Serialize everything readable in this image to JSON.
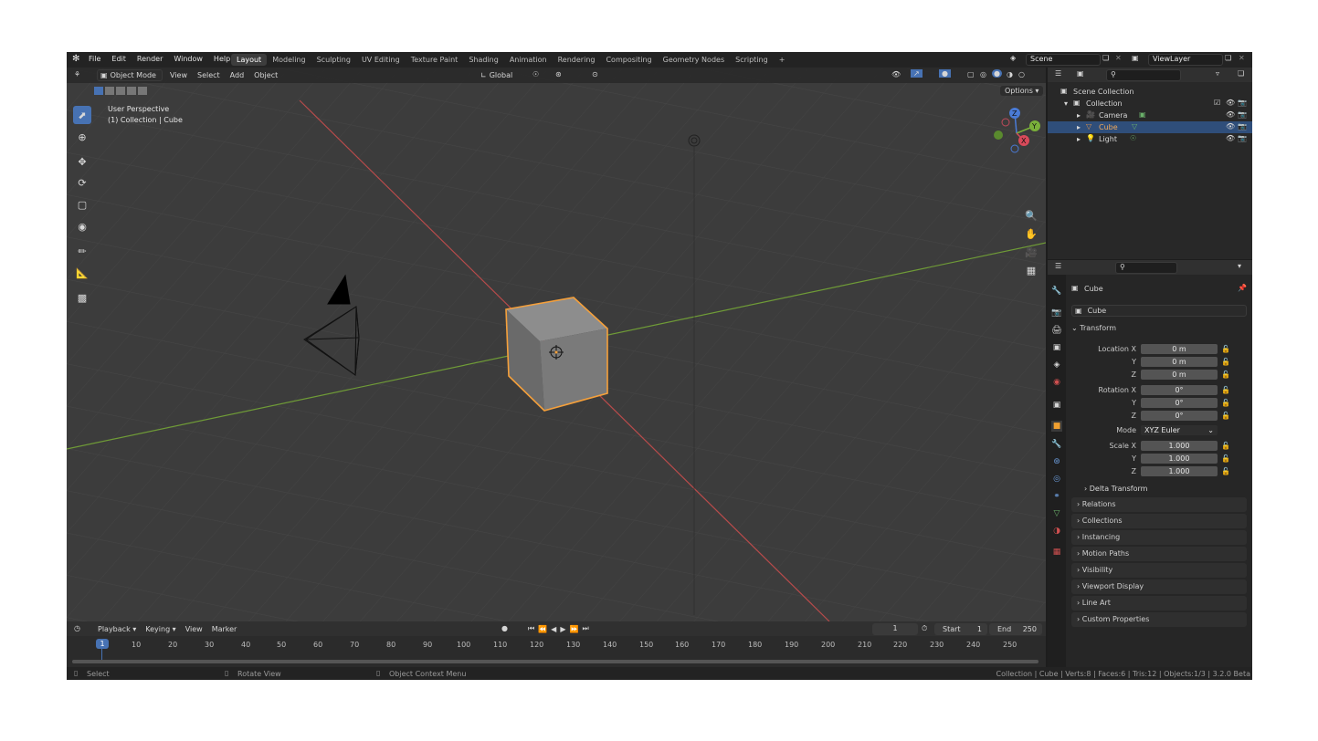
{
  "menubar": {
    "items": [
      "File",
      "Edit",
      "Render",
      "Window",
      "Help"
    ],
    "workspaces": [
      "Layout",
      "Modeling",
      "Sculpting",
      "UV Editing",
      "Texture Paint",
      "Shading",
      "Animation",
      "Rendering",
      "Compositing",
      "Geometry Nodes",
      "Scripting"
    ],
    "active_workspace": "Layout",
    "add_tab": "+",
    "scene": "Scene",
    "view_layer": "ViewLayer"
  },
  "viewport": {
    "mode": "Object Mode",
    "menus": [
      "View",
      "Select",
      "Add",
      "Object"
    ],
    "orientation": "Global",
    "options_label": "Options",
    "perspective_text": "User Perspective",
    "collection_text": "(1) Collection | Cube",
    "gizmo_axes": [
      "Z",
      "Y",
      "X"
    ]
  },
  "outliner": {
    "root": "Scene Collection",
    "rows": [
      {
        "label": "Collection",
        "selected": false
      },
      {
        "label": "Camera",
        "selected": false
      },
      {
        "label": "Cube",
        "selected": true
      },
      {
        "label": "Light",
        "selected": false
      }
    ]
  },
  "properties": {
    "object_name": "Cube",
    "data_name": "Cube",
    "transform_label": "Transform",
    "location": {
      "label": "Location X",
      "x": "0 m",
      "y": "0 m",
      "z": "0 m"
    },
    "rotation": {
      "label": "Rotation X",
      "x": "0°",
      "y": "0°",
      "z": "0°"
    },
    "mode": {
      "label": "Mode",
      "value": "XYZ Euler"
    },
    "scale": {
      "label": "Scale X",
      "x": "1.000",
      "y": "1.000",
      "z": "1.000"
    },
    "axis_y": "Y",
    "axis_z": "Z",
    "delta": "Delta Transform",
    "panels": [
      "Relations",
      "Collections",
      "Instancing",
      "Motion Paths",
      "Visibility",
      "Viewport Display",
      "Line Art",
      "Custom Properties"
    ]
  },
  "timeline": {
    "menus": [
      "Playback",
      "Keying",
      "View",
      "Marker"
    ],
    "current_frame": "1",
    "start_label": "Start",
    "start_value": "1",
    "end_label": "End",
    "end_value": "250",
    "ticks": [
      "10",
      "20",
      "30",
      "40",
      "50",
      "60",
      "70",
      "80",
      "90",
      "100",
      "110",
      "120",
      "130",
      "140",
      "150",
      "160",
      "170",
      "180",
      "190",
      "200",
      "210",
      "220",
      "230",
      "240",
      "250"
    ],
    "playhead": "1"
  },
  "statusbar": {
    "select": "Select",
    "rotate": "Rotate View",
    "context": "Object Context Menu",
    "stats": "Collection | Cube | Verts:8 | Faces:6 | Tris:12 | Objects:1/3 | 3.2.0 Beta"
  },
  "colors": {
    "accent": "#4772b3",
    "selection_outline": "#f5a03b",
    "x_axis": "#b84b4b",
    "y_axis": "#6f9b37"
  }
}
